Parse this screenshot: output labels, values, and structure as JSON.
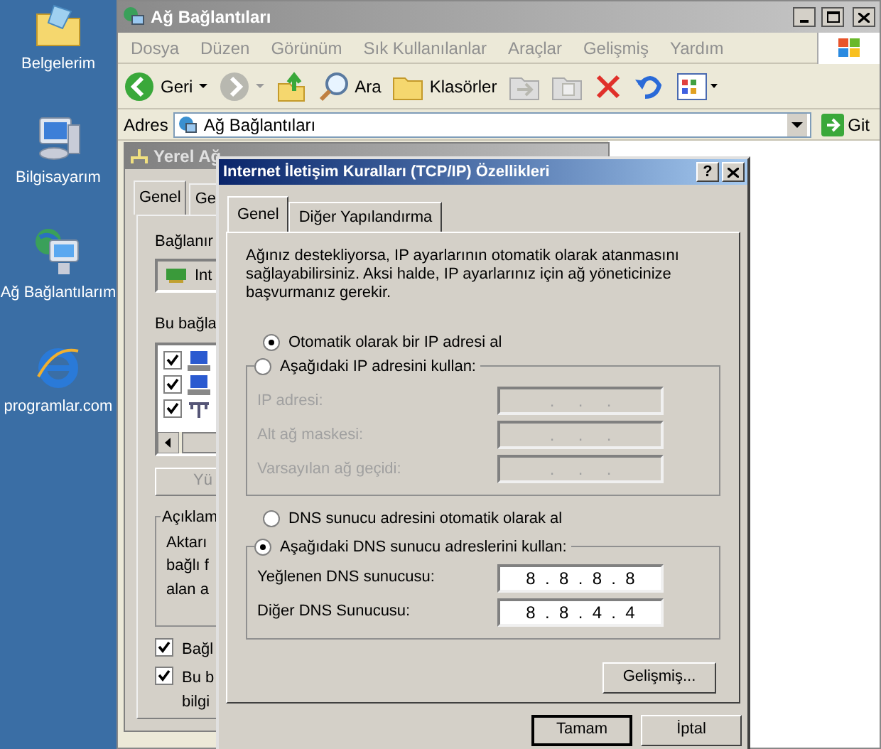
{
  "desktop_icons": [
    {
      "label": "Belgelerim",
      "kind": "folder"
    },
    {
      "label": "Bilgisayarım",
      "kind": "computer"
    },
    {
      "label": "Ağ Bağlantılarım",
      "kind": "network"
    },
    {
      "label": "programlar.com",
      "kind": "browser"
    }
  ],
  "explorer": {
    "title": "Ağ Bağlantıları",
    "menu": [
      "Dosya",
      "Düzen",
      "Görünüm",
      "Sık Kullanılanlar",
      "Araçlar",
      "Gelişmiş",
      "Yardım"
    ],
    "toolbar": [
      {
        "kind": "back",
        "label": "Geri",
        "disabled": false
      },
      {
        "kind": "forward",
        "disabled": true
      },
      {
        "kind": "up",
        "disabled": false
      },
      {
        "kind": "search",
        "label": "Ara"
      },
      {
        "kind": "folders",
        "label": "Klasörler"
      },
      {
        "kind": "move",
        "disabled": true
      },
      {
        "kind": "copy",
        "disabled": true
      },
      {
        "kind": "delete",
        "disabled": false
      },
      {
        "kind": "undo",
        "disabled": false
      },
      {
        "kind": "views"
      }
    ],
    "address_label": "Adres",
    "address": "Ağ Bağlantıları",
    "go_label": "Git"
  },
  "back_dialog": {
    "title": "Yerel Ağ",
    "tabs": [
      {
        "label": "Genel",
        "selected": true
      },
      {
        "label": "Ge",
        "selected": false
      }
    ],
    "connect_label": "Bağlanır",
    "adapter": "Int",
    "items_label": "Bu bağla",
    "items": [
      {
        "checked": true,
        "kind": "computer"
      },
      {
        "checked": true,
        "kind": "computer"
      },
      {
        "checked": true,
        "kind": "protocol"
      }
    ],
    "button": "Yü",
    "group_label": "Açıklam",
    "description": [
      "Aktarı",
      "bağlı f",
      "alan a"
    ],
    "options": [
      {
        "lines": [
          "Bağl"
        ],
        "checked": true
      },
      {
        "lines": [
          "Bu b",
          "bilgi"
        ],
        "checked": true
      }
    ]
  },
  "dialog": {
    "title": "Internet İletişim Kuralları (TCP/IP) Özellikleri",
    "help": "?",
    "tabs": [
      {
        "label": "Genel",
        "selected": true
      },
      {
        "label": "Diğer Yapılandırma",
        "selected": false
      }
    ],
    "intro": "Ağınız destekliyorsa, IP ayarlarının otomatik olarak atanmasını sağlayabilirsiniz. Aksi halde, IP ayarlarınız için ağ yöneticinize başvurmanız gerekir.",
    "ip_auto": {
      "label": "Otomatik olarak bir IP adresi al",
      "selected": true
    },
    "ip_manual": {
      "label": "Aşağıdaki IP adresini kullan:",
      "selected": false,
      "fields": [
        {
          "label": "IP adresi:",
          "value": ".     .     .",
          "disabled": true
        },
        {
          "label": "Alt ağ maskesi:",
          "value": ".     .     .",
          "disabled": true
        },
        {
          "label": "Varsayılan ağ geçidi:",
          "value": ".     .     .",
          "disabled": true
        }
      ]
    },
    "dns_auto": {
      "label": "DNS sunucu adresini otomatik olarak al",
      "selected": false
    },
    "dns_manual": {
      "label": "Aşağıdaki DNS sunucu adreslerini kullan:",
      "selected": true,
      "fields": [
        {
          "label": "Yeğlenen DNS sunucusu:",
          "value": "8  .  8  .  8  .  8",
          "disabled": false
        },
        {
          "label": "Diğer DNS Sunucusu:",
          "value": "8  .  8  .  4  .  4",
          "disabled": false
        }
      ]
    },
    "advanced": "Gelişmiş...",
    "ok": "Tamam",
    "cancel": "İptal"
  }
}
